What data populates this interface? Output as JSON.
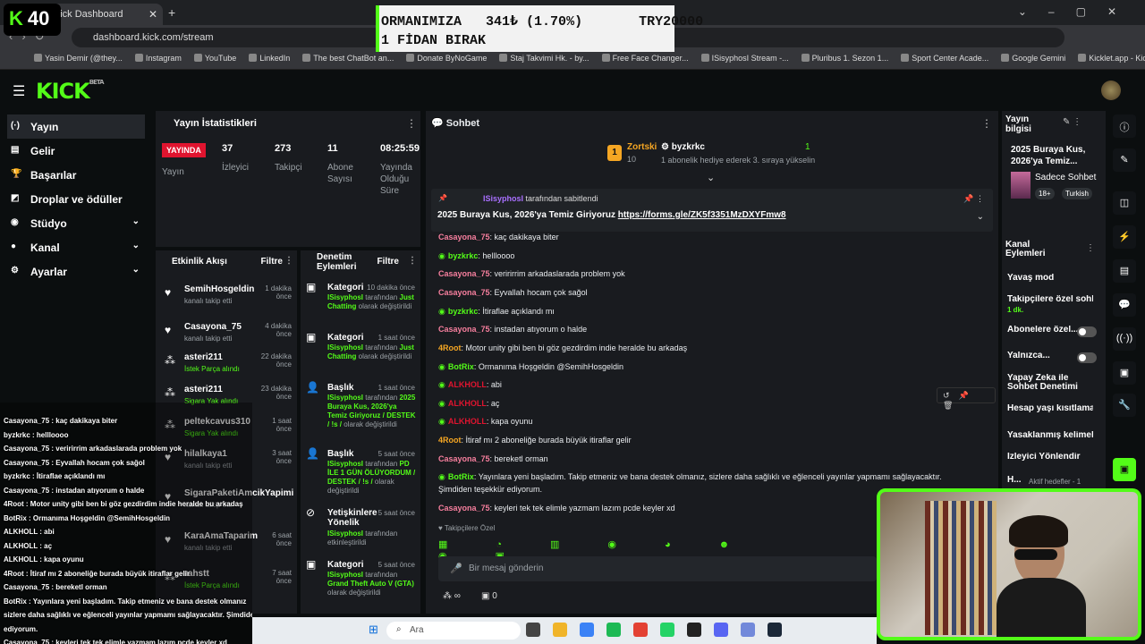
{
  "browser": {
    "tab_title": "n - Kick Dashboard",
    "url": "dashboard.kick.com/stream",
    "bookmarks": [
      "Yasin Demir (@they...",
      "Instagram",
      "YouTube",
      "LinkedIn",
      "The best ChatBot an...",
      "Donate ByNoGame",
      "Staj Takvimi Hk. - by...",
      "Free Face Changer...",
      "ISisyphosI Stream -...",
      "Pluribus 1. Sezon 1...",
      "Sport Center Acade...",
      "Google Gemini",
      "Kicklet.app - Kick C..."
    ]
  },
  "kbadge": {
    "k": "K",
    "count": "40"
  },
  "ticker": {
    "line1": "ORMANIMIZA   341₺ (1.70%)       TRY20000",
    "line2": "1 FİDAN BIRAK"
  },
  "brand": {
    "logo": "KICK",
    "beta": "BETA",
    "accent": "#53fc18"
  },
  "nav": [
    {
      "label": "Yayın",
      "icon": "(·)"
    },
    {
      "label": "Gelir",
      "icon": "▤"
    },
    {
      "label": "Başarılar",
      "icon": "🏆"
    },
    {
      "label": "Droplar ve ödüller",
      "icon": "◩"
    },
    {
      "label": "Stüdyo",
      "icon": "◉"
    },
    {
      "label": "Kanal",
      "icon": "●"
    },
    {
      "label": "Ayarlar",
      "icon": "⚙"
    }
  ],
  "stats": {
    "title": "Yayın İstatistikleri",
    "live": "YAYINDA",
    "live_label": "Yayın",
    "viewers": "37",
    "viewers_label": "İzleyici",
    "followers": "273",
    "followers_label": "Takipçi",
    "subs": "11",
    "subs_label": "Abone Sayısı",
    "uptime": "08:25:59",
    "uptime_label": "Yayında Olduğu Süre"
  },
  "activity": {
    "title": "Etkinlik Akışı",
    "filter": "Filtre",
    "items": [
      {
        "name": "SemihHosgeldin",
        "time": "1 dakika önce",
        "sub": "kanalı takip etti"
      },
      {
        "name": "Casayona_75",
        "time": "4 dakika önce",
        "sub": "kanalı takip etti"
      },
      {
        "name": "asteri211",
        "time": "22 dakika önce",
        "sub": "İstek Parça alındı"
      },
      {
        "name": "asteri211",
        "time": "23 dakika önce",
        "sub": "Sigara Yak alındı"
      },
      {
        "name": "peltekcavus310",
        "time": "1 saat önce",
        "sub": "Sigara Yak alındı"
      },
      {
        "name": "hilalkaya1",
        "time": "3 saat önce",
        "sub": "kanalı takip etti"
      },
      {
        "name": "SigaraPaketiAmcikYapimi",
        "time": "",
        "sub": "kanalı takip etti"
      },
      {
        "name": "KaraAmaTaparim",
        "time": "6 saat önce",
        "sub": "kanalı takip etti"
      },
      {
        "name": "rahstt",
        "time": "7 saat önce",
        "sub": "İstek Parça alındı"
      }
    ]
  },
  "moderation": {
    "title": "Denetim Eylemleri",
    "filter": "Filtre",
    "items": [
      {
        "name": "Kategori",
        "time": "10 dakika önce",
        "actor": "ISisyphosI",
        "mid": " tarafından ",
        "value": "Just Chatting",
        "tail": " olarak değiştirildi"
      },
      {
        "name": "Kategori",
        "time": "1 saat önce",
        "actor": "ISisyphosI",
        "mid": " tarafından ",
        "value": "Just Chatting",
        "tail": " olarak değiştirildi"
      },
      {
        "name": "Başlık",
        "time": "1 saat önce",
        "actor": "ISisyphosI",
        "mid": " tarafından ",
        "value": "2025 Buraya Kus, 2026'ya Temiz Giriyoruz / DESTEK / !s /",
        "tail": " olarak değiştirildi"
      },
      {
        "name": "Başlık",
        "time": "5 saat önce",
        "actor": "ISisyphosI",
        "mid": " tarafından ",
        "value": "PD İLE 1 GÜN ÖLÜYORDUM / DESTEK / !s /",
        "tail": " olarak değiştirildi"
      },
      {
        "name": "Yetişkinlere Yönelik",
        "time": "5 saat önce",
        "actor": "ISisyphosI",
        "mid": " tarafından ",
        "value": "",
        "tail": "etkinleştirildi"
      },
      {
        "name": "Kategori",
        "time": "5 saat önce",
        "actor": "ISisyphosI",
        "mid": " tarafından ",
        "value": "Grand Theft Auto V (GTA)",
        "tail": " olarak değiştirildi"
      }
    ]
  },
  "chat": {
    "title": "Sohbet",
    "gift_user": "Zortski",
    "gift_count": "10",
    "gift_target": "byzkrkc",
    "gift_rank": "1",
    "gift_text": "1 abonelik hediye ederek 3. sıraya yükselin",
    "pinned_by": "ISisyphosI",
    "pinned_by_suffix": " tarafından sabitlendi",
    "pinned_text": "2025 Buraya Kus, 2026'ya Temiz Giriyoruz ",
    "pinned_link": "https://forms.gle/ZK5f3351MzDXYFmw8",
    "messages": [
      {
        "user": "Casayona_75",
        "color": "#f77f9e",
        "text": ": kaç dakikaya biter"
      },
      {
        "user": "byzkrkc",
        "color": "#53fc18",
        "text": ": hellloooo"
      },
      {
        "user": "Casayona_75",
        "color": "#f77f9e",
        "text": ": veririrrim arkadaslarada problem yok"
      },
      {
        "user": "Casayona_75",
        "color": "#f77f9e",
        "text": ": Eyvallah hocam çok sağol"
      },
      {
        "user": "byzkrkc",
        "color": "#53fc18",
        "text": ": İtiraflae açıklandı mı"
      },
      {
        "user": "Casayona_75",
        "color": "#f77f9e",
        "text": ": instadan atıyorum o halde"
      },
      {
        "user": "4Root",
        "color": "#f5a623",
        "text": ": Motor unity gibi ben bi göz gezdirdim indie heralde bu arkadaş"
      },
      {
        "user": "BotRix",
        "color": "#53fc18",
        "text": ": Ormanıma Hoşgeldin @SemihHosgeldin"
      },
      {
        "user": "ALKHOLL",
        "color": "#e0142f",
        "text": ": abi"
      },
      {
        "user": "ALKHOLL",
        "color": "#e0142f",
        "text": ": aç"
      },
      {
        "user": "ALKHOLL",
        "color": "#e0142f",
        "text": ": kapa oyunu"
      },
      {
        "user": "4Root",
        "color": "#f5a623",
        "text": ": İtiraf mı 2 aboneliğe burada büyük itiraflar gelir"
      },
      {
        "user": "Casayona_75",
        "color": "#f77f9e",
        "text": ": bereketl orman"
      },
      {
        "user": "BotRix",
        "color": "#53fc18",
        "text": ": Yayınlara yeni başladım. Takip etmeniz ve bana destek olmanız, sizlere daha sağlıklı ve eğlenceli yayınlar yapmamı sağlayacaktır."
      },
      {
        "user": "",
        "color": "#e9ecef",
        "text": "Şimdiden teşekkür ediyorum."
      },
      {
        "user": "Casayona_75",
        "color": "#f77f9e",
        "text": ": keyleri tek tek elimle yazmam lazım pcde keyler xd"
      }
    ],
    "followers_only": "Takipçilere Özel",
    "input_placeholder": "Bir mesaj gönderin",
    "points": "0"
  },
  "stream_info": {
    "title": "Yayın bilgisi",
    "stream_title": "2025 Buraya Kus, 2026'ya Temiz...",
    "category": "Sadece Sohbet",
    "age": "18+",
    "lang": "Turkish"
  },
  "channel_actions": {
    "title": "Kanal Eylemleri",
    "items": [
      "Yavaş mod",
      "Takipçilere özel sohbet",
      "Abonelere özel...",
      "Yalnızca...",
      "Yapay Zeka ile Sohbet Denetimi",
      "Hesap yaşı kısıtlama",
      "Yasaklanmış kelimeler",
      "İzleyici Yönlendir",
      "H..."
    ],
    "follower_sub": "1 dk.",
    "goals": "Aktif hedefler - 1"
  },
  "overlay_lines": [
    "Casayona_75 : kaç dakikaya biter",
    "byzkrkc : hellloooo",
    "Casayona_75 : veririrrim arkadaslarada problem yok",
    "Casayona_75 : Eyvallah hocam çok sağol",
    "byzkrkc : İtiraflae açıklandı mı",
    "Casayona_75 : instadan atıyorum o halde",
    "4Root : Motor unity gibi ben bi göz gezdirdim indie heralde bu arkadaş",
    "BotRix : Ormanıma Hoşgeldin @SemihHosgeldin",
    "ALKHOLL : abi",
    "ALKHOLL : aç",
    "ALKHOLL : kapa oyunu",
    "4Root : İtiraf mı 2 aboneliğe burada büyük itiraflar gelir",
    "Casayona_75 : bereketl orman",
    "BotRix : Yayınlara yeni başladım. Takip etmeniz ve bana destek olmanız",
    "sizlere daha sağlıklı ve eğlenceli yayınlar yapmamı sağlayacaktır. Şimdiden",
    "ediyorum.",
    "Casayona_75 : keyleri tek tek elimle yazmam lazım pcde keyler xd"
  ],
  "taskbar": {
    "search": "Ara"
  }
}
